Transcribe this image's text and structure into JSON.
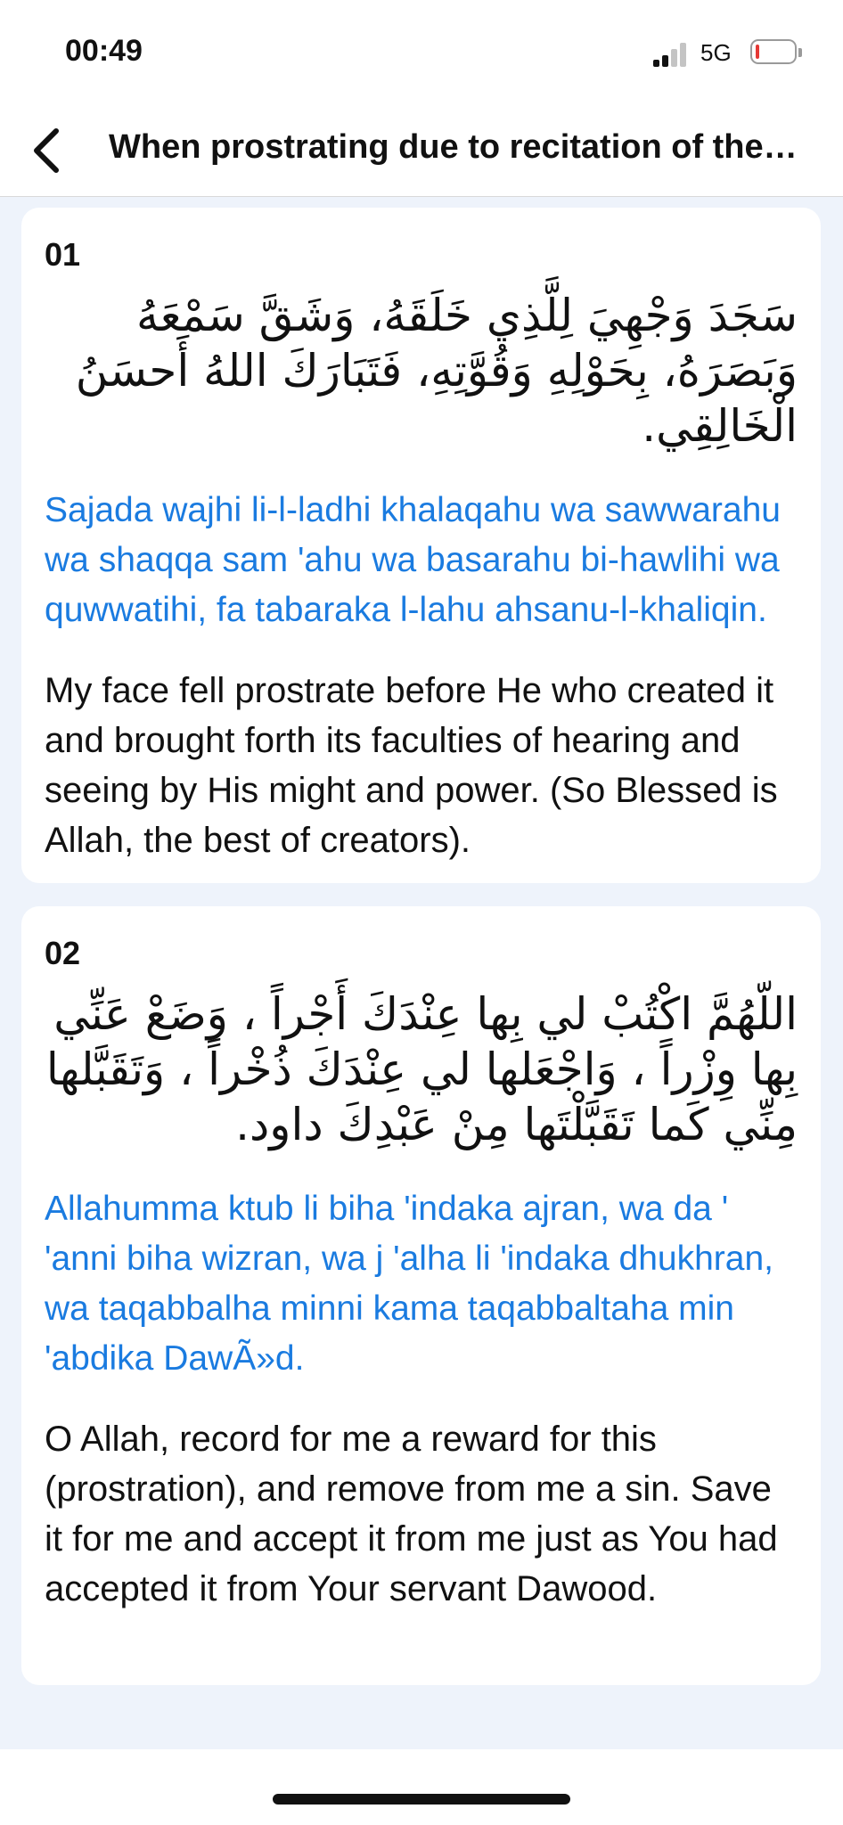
{
  "status_bar": {
    "time": "00:49",
    "network": "5G",
    "battery_level_fraction": 0.1
  },
  "nav": {
    "back_icon": "chevron-left-icon",
    "title": "When prostrating due to recitation of the Qur'an"
  },
  "duas": [
    {
      "number": "01",
      "arabic": "سَجَدَ وَجْهِيَ لِلَّذِي خَلَقَهُ، وَشَقَّ سَمْعَهُ وَبَصَرَهُ، بِحَوْلِهِ وَقُوَّتِهِ، فَتَبَارَكَ اللهُ أَحسَنُ الْخَالِقِي.",
      "transliteration": "Sajada wajhi li-l-ladhi khalaqahu wa sawwarahu wa shaqqa sam 'ahu wa basarahu bi-hawlihi wa quwwatihi, fa tabaraka l-lahu ahsanu-l-khaliqin.",
      "translation": "My face fell prostrate before He who created it and brought forth its faculties of hearing and seeing by His might and power. (So Blessed is Allah, the best of creators)."
    },
    {
      "number": "02",
      "arabic": "اللّهُمَّ اكْتُبْ لي بِها عِنْدَكَ أَجْراً ، وَضَعْ عَنِّي بِها وِزْراً ، وَاجْعَلها لي عِنْدَكَ ذُخْراً ، وَتَقَبَّلها مِنِّي كَما تَقَبَّلْتَها مِنْ عَبْدِكَ داود.",
      "transliteration": "Allahumma ktub li biha 'indaka ajran, wa da ' 'anni biha wizran, wa j 'alha li 'indaka dhukhran, wa taqabbalha minni kama taqabbaltaha min 'abdika DawÃ»d.",
      "translation": "O Allah, record for me a reward for this (prostration), and remove from me a sin. Save it for me and accept it from me just as You had accepted it from Your servant Dawood."
    }
  ]
}
